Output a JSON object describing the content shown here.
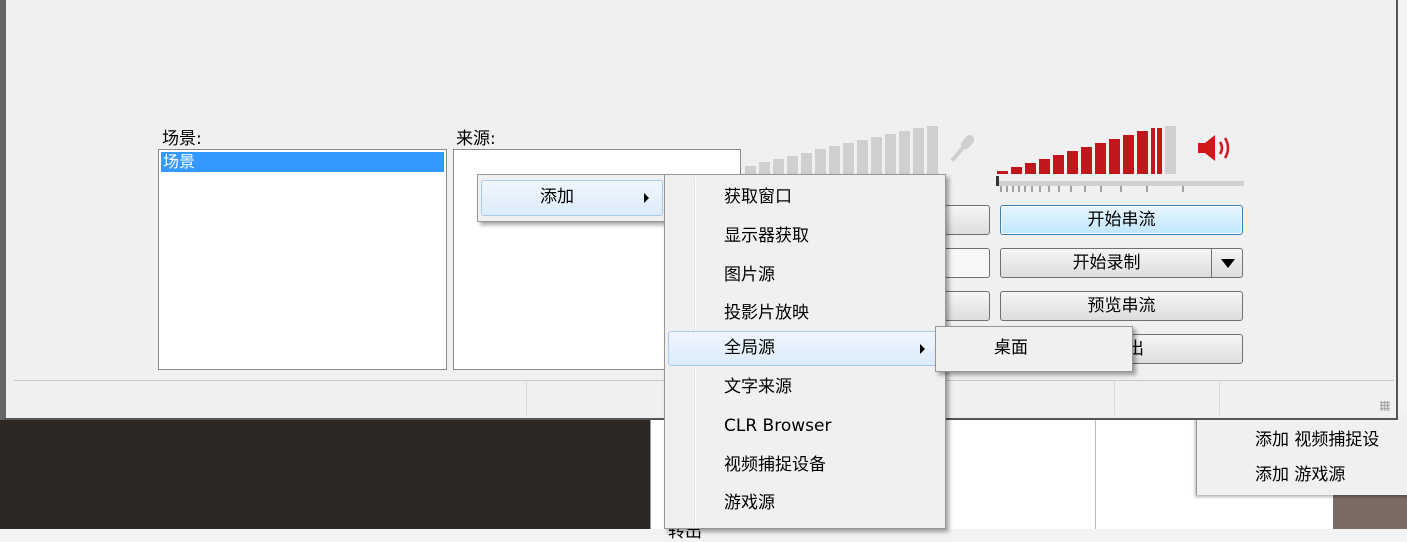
{
  "scenes": {
    "label": "场景:",
    "items": [
      "场景"
    ]
  },
  "sources": {
    "label": "来源:"
  },
  "buttons": {
    "start_stream": "开始串流",
    "start_record": "开始录制",
    "preview_stream": "预览串流",
    "partial_button_text": "出"
  },
  "context_menu": {
    "add": "添加"
  },
  "submenu": {
    "items": [
      "获取窗口",
      "显示器获取",
      "图片源",
      "投影片放映",
      "全局源",
      "文字来源",
      "CLR Browser",
      "视频捕捉设备",
      "游戏源"
    ],
    "highlighted_index": 4
  },
  "global_source_submenu": {
    "items": [
      "桌面"
    ]
  },
  "background_menu": {
    "items": [
      "添加 视频捕捉设",
      "添加 游戏源"
    ]
  },
  "background_cut_text": "转出",
  "colors": {
    "selection": "#3399ff",
    "meter_red": "#c0161c",
    "meter_gray": "#cfcfcf",
    "focus_border": "#3c7fb1"
  }
}
